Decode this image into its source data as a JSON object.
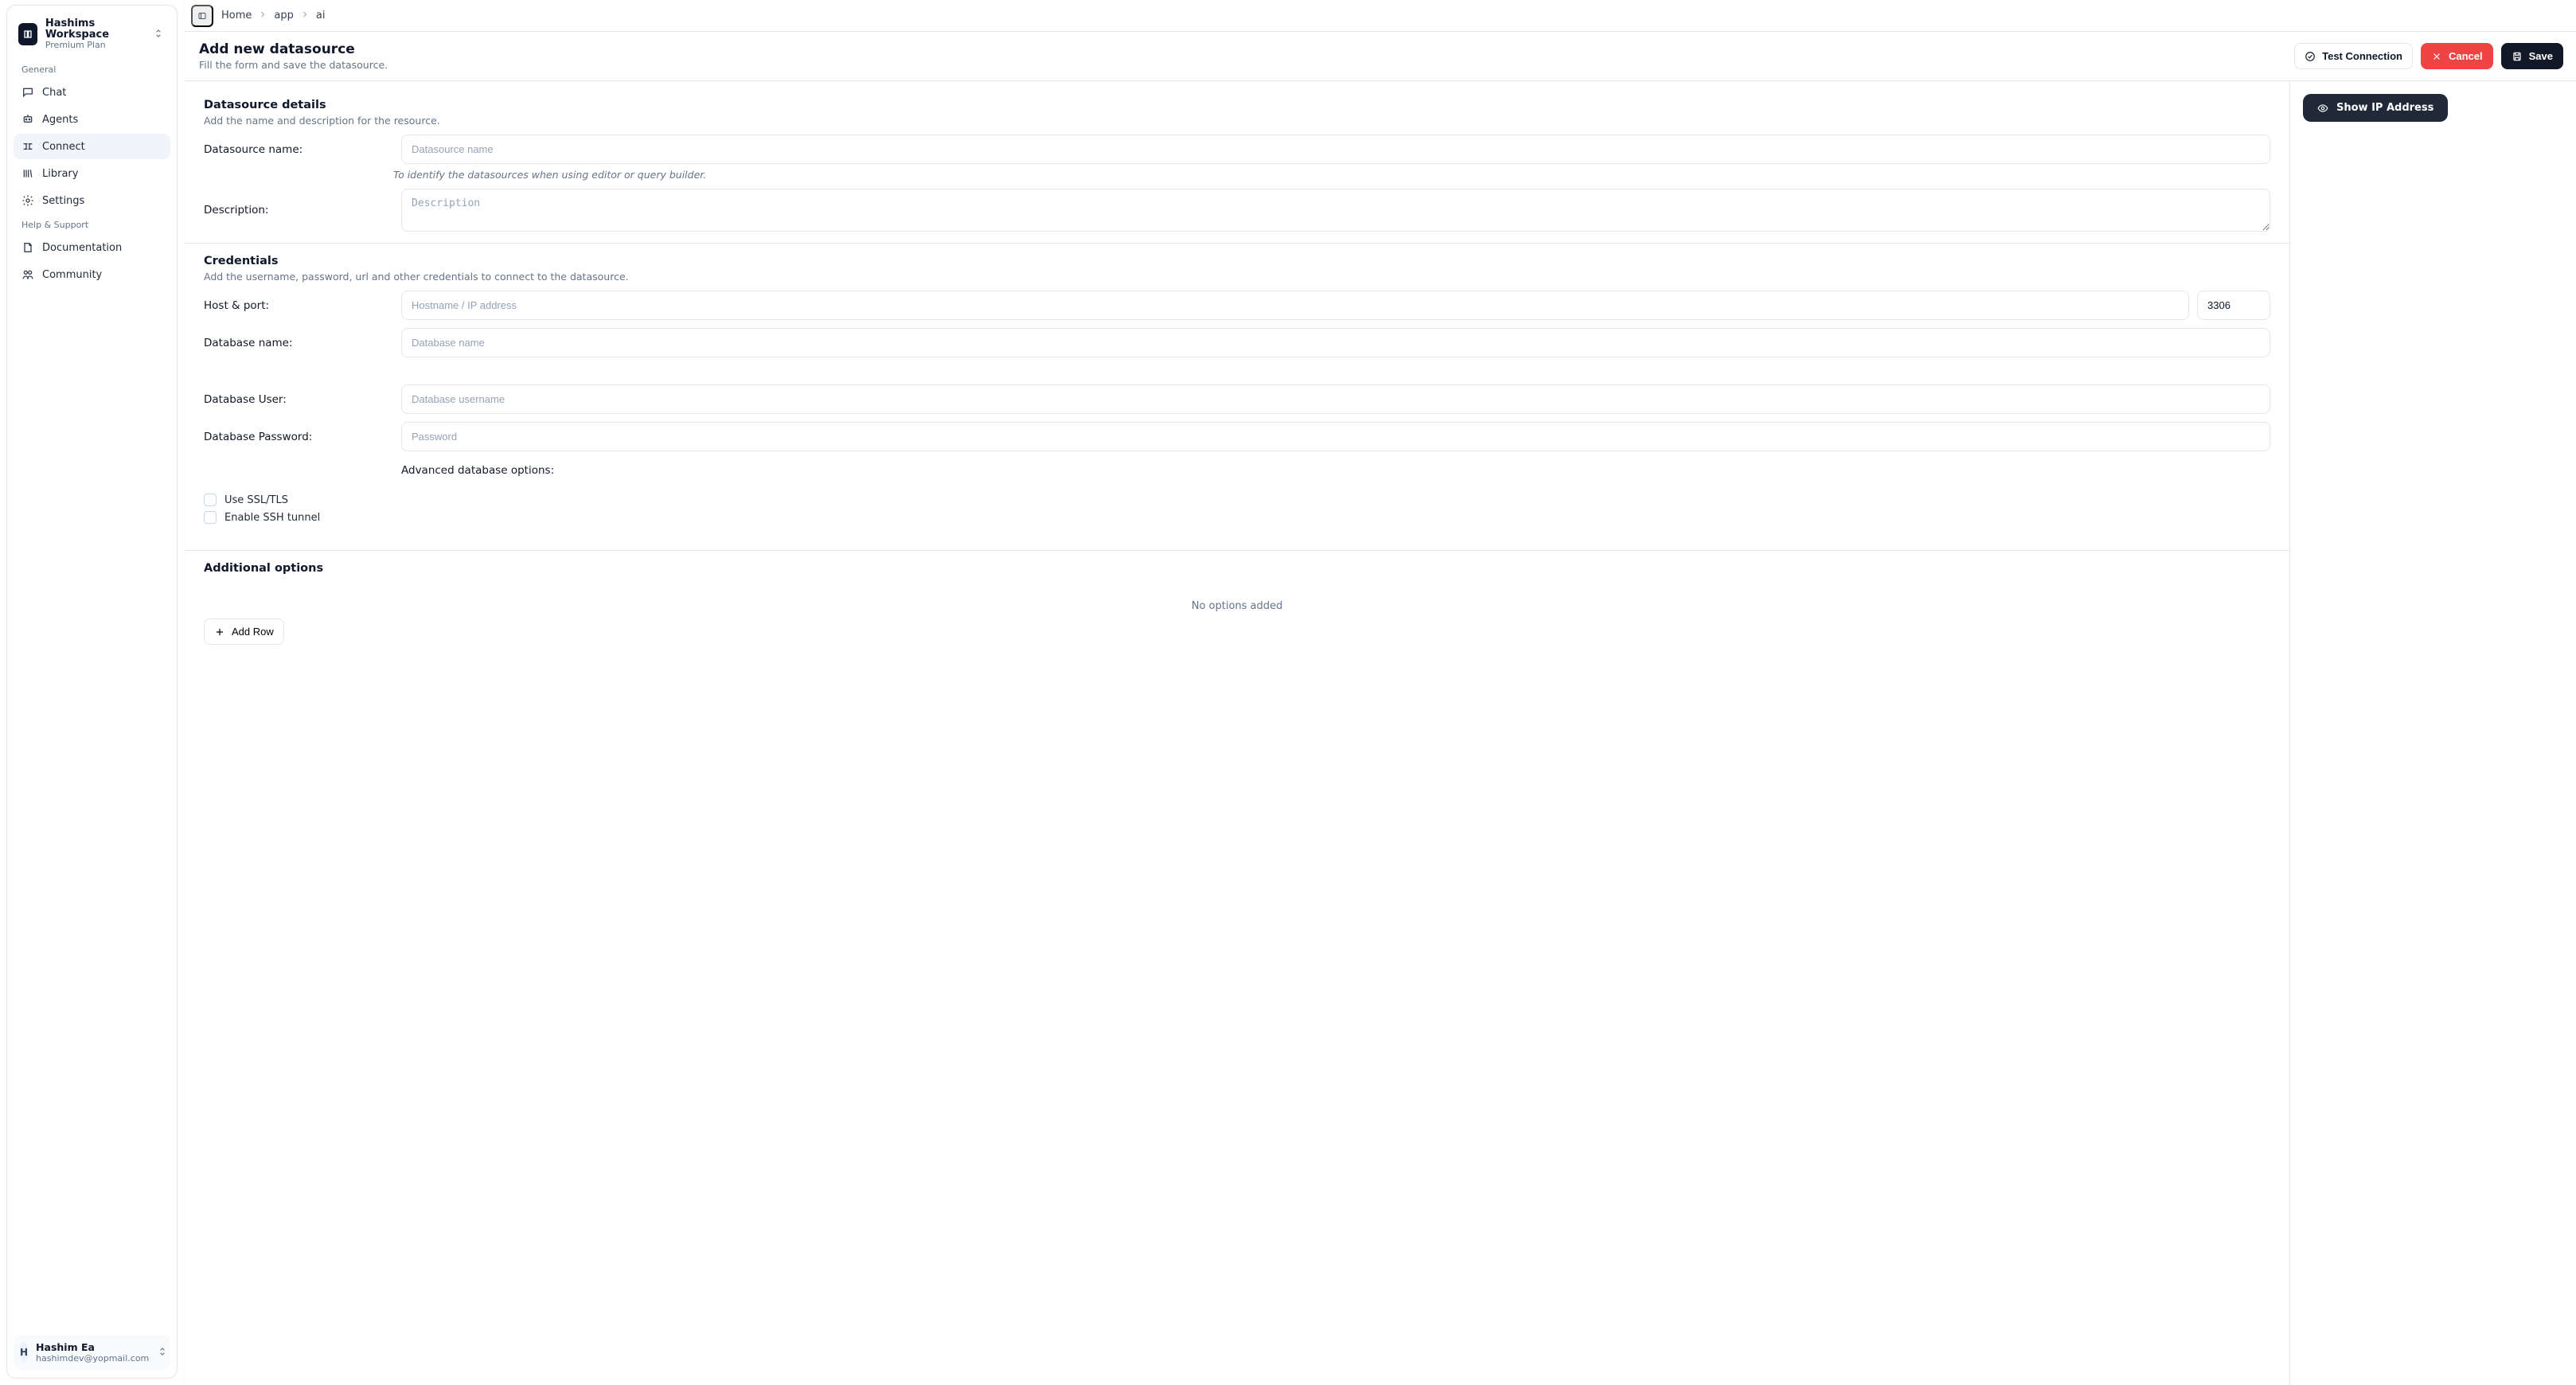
{
  "workspace": {
    "name": "Hashims Workspace",
    "plan": "Premium Plan"
  },
  "sidebar": {
    "general_label": "General",
    "help_label": "Help & Support",
    "items": {
      "chat": "Chat",
      "agents": "Agents",
      "connect": "Connect",
      "library": "Library",
      "settings": "Settings",
      "documentation": "Documentation",
      "community": "Community"
    },
    "user": {
      "avatar_initial": "H",
      "name": "Hashim Ea",
      "email": "hashimdev@yopmail.com"
    }
  },
  "breadcrumbs": {
    "home": "Home",
    "app": "app",
    "ai": "ai"
  },
  "header": {
    "title": "Add new datasource",
    "subtitle": "Fill the form and save the datasource.",
    "test": "Test Connection",
    "cancel": "Cancel",
    "save": "Save"
  },
  "right": {
    "show_ip": "Show IP Address"
  },
  "details": {
    "title": "Datasource details",
    "subtitle": "Add the name and description for the resource.",
    "name_label": "Datasource name:",
    "name_placeholder": "Datasource name",
    "name_help": "To identify the datasources when using editor or query builder.",
    "desc_label": "Description:",
    "desc_placeholder": "Description"
  },
  "creds": {
    "title": "Credentials",
    "subtitle": "Add the username, password, url and other credentials to connect to the datasource.",
    "host_label": "Host & port:",
    "host_placeholder": "Hostname / IP address",
    "port_value": "3306",
    "dbname_label": "Database name:",
    "dbname_placeholder": "Database name",
    "dbuser_label": "Database User:",
    "dbuser_placeholder": "Database username",
    "dbpass_label": "Database Password:",
    "dbpass_placeholder": "Password",
    "advanced_label": "Advanced database options:",
    "use_ssl": "Use SSL/TLS",
    "ssh_tunnel": "Enable SSH tunnel"
  },
  "additional": {
    "title": "Additional options",
    "empty": "No options added",
    "add_row": "Add Row"
  }
}
